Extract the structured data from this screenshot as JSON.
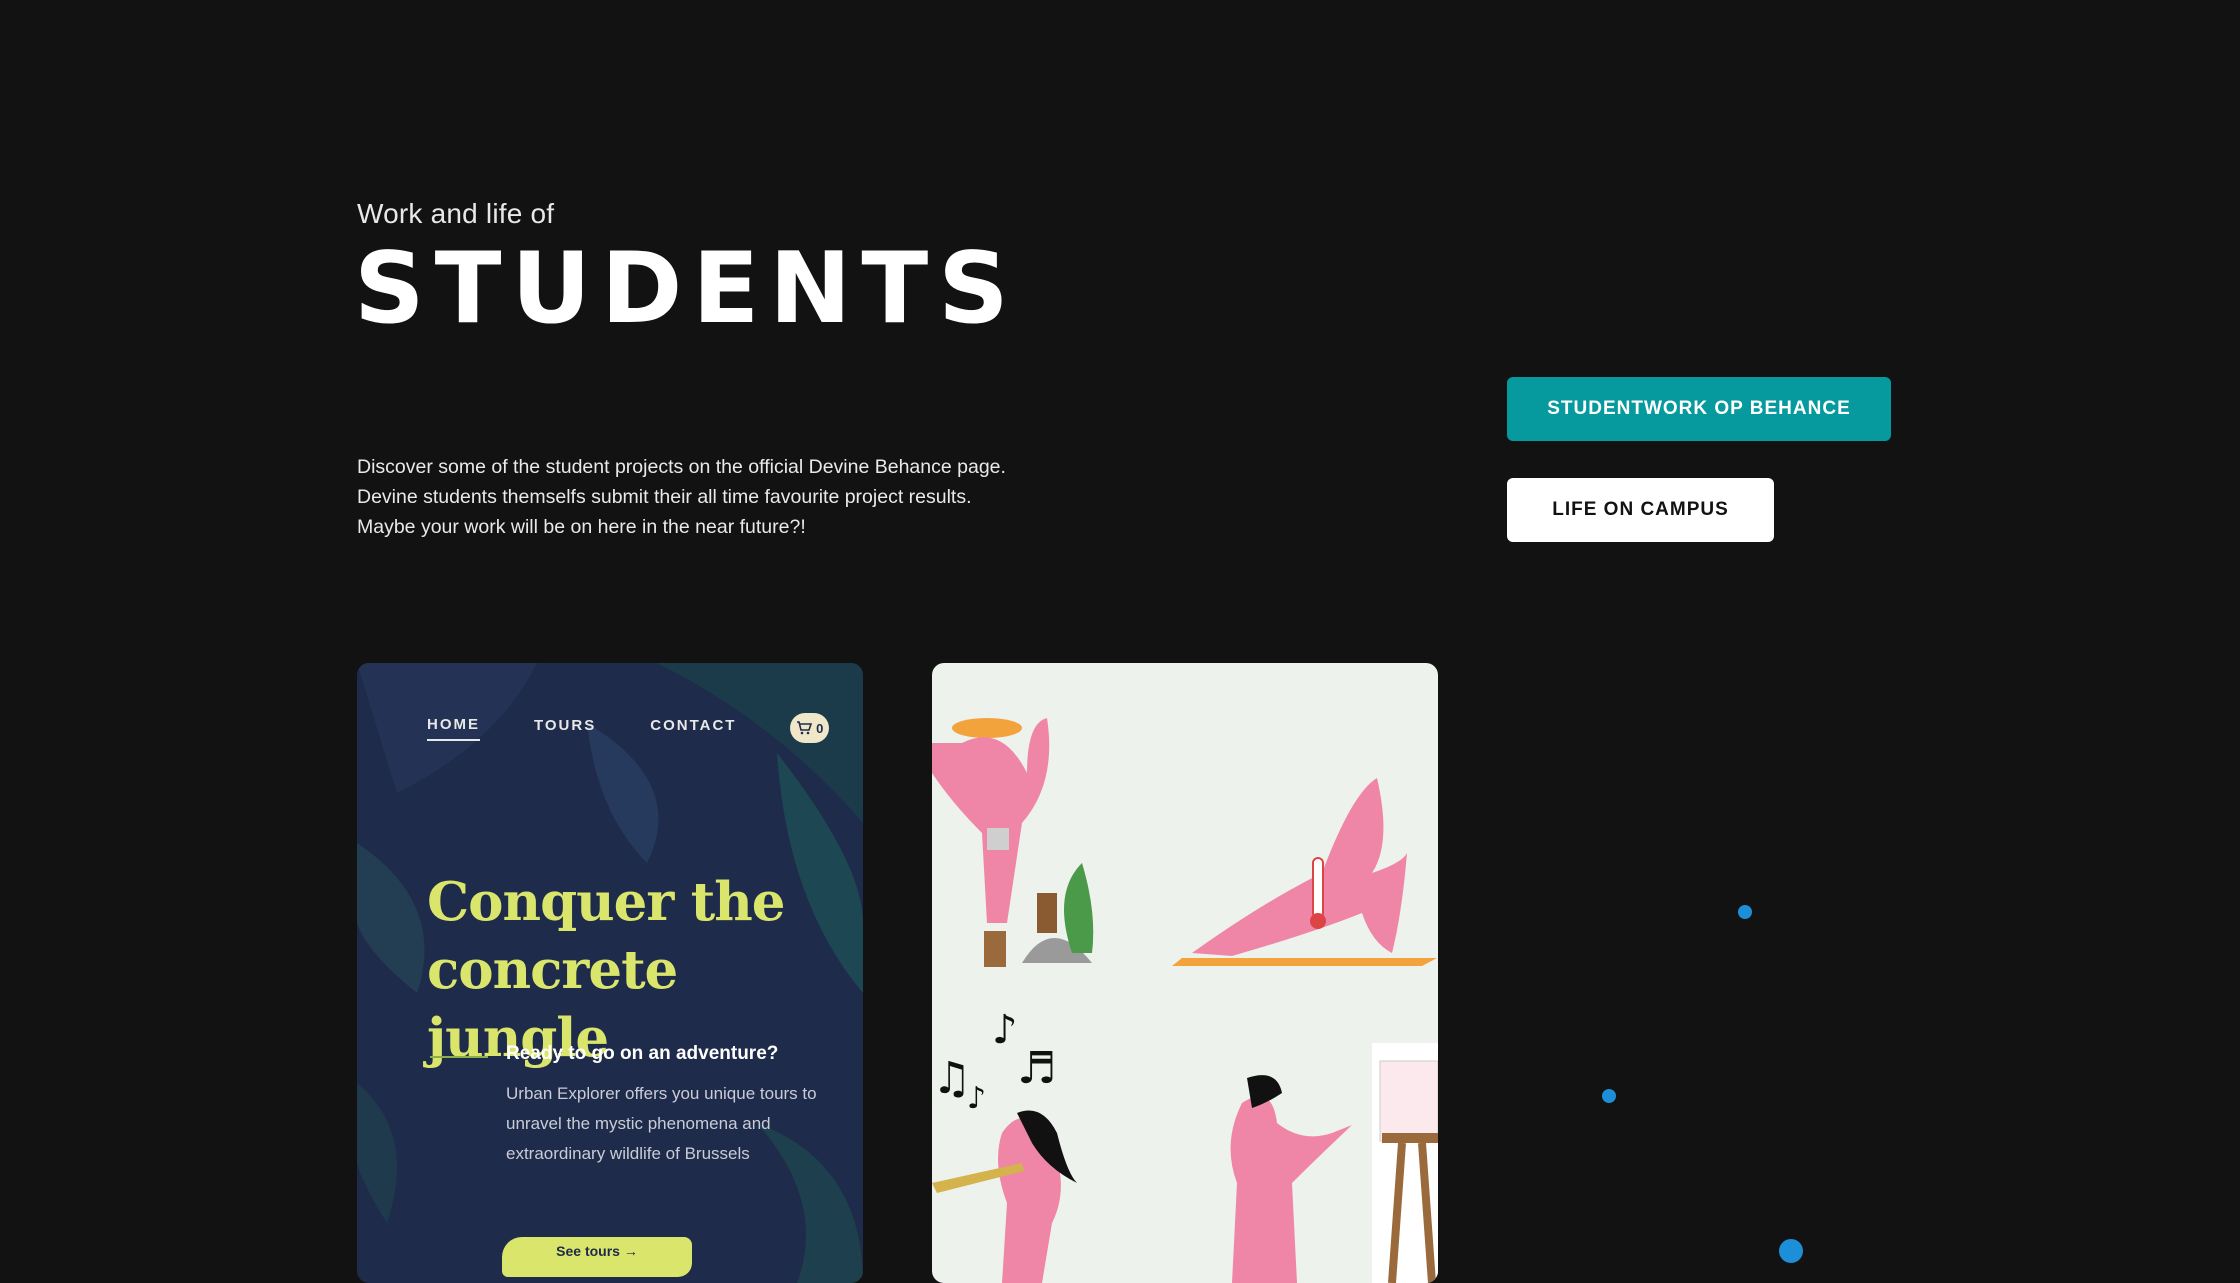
{
  "hero": {
    "kicker": "Work and life of",
    "title": "STUDENTS",
    "intro": "Discover some of the student projects on the official Devine Behance page. Devine students themselfs submit their all time favourite project results. Maybe your work will be on here in the near future?!"
  },
  "buttons": {
    "behance": "STUDENTWORK OP BEHANCE",
    "campus": "LIFE ON CAMPUS"
  },
  "cards": {
    "jungle": {
      "nav": [
        "HOME",
        "TOURS",
        "CONTACT"
      ],
      "cart_count": "0",
      "headline": "Conquer the concrete jungle",
      "subheading": "Ready to go on an adventure?",
      "body": "Urban Explorer offers you unique tours to unravel the mystic phenomena and extraordinary wildlife of  Brussels",
      "cta": "See tours →"
    }
  },
  "colors": {
    "background": "#121212",
    "accent": "#069a9e",
    "jungle_bg": "#1f2b4a",
    "jungle_yellow": "#d9e56b",
    "illus_pink": "#ef86a8",
    "dot_blue": "#1c8fd8"
  }
}
